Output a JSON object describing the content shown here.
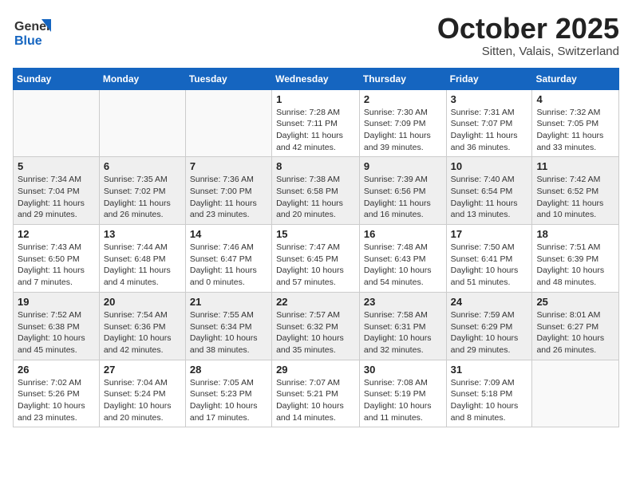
{
  "header": {
    "logo_general": "General",
    "logo_blue": "Blue",
    "month": "October 2025",
    "location": "Sitten, Valais, Switzerland"
  },
  "weekdays": [
    "Sunday",
    "Monday",
    "Tuesday",
    "Wednesday",
    "Thursday",
    "Friday",
    "Saturday"
  ],
  "weeks": [
    [
      {
        "day": "",
        "info": ""
      },
      {
        "day": "",
        "info": ""
      },
      {
        "day": "",
        "info": ""
      },
      {
        "day": "1",
        "info": "Sunrise: 7:28 AM\nSunset: 7:11 PM\nDaylight: 11 hours and 42 minutes."
      },
      {
        "day": "2",
        "info": "Sunrise: 7:30 AM\nSunset: 7:09 PM\nDaylight: 11 hours and 39 minutes."
      },
      {
        "day": "3",
        "info": "Sunrise: 7:31 AM\nSunset: 7:07 PM\nDaylight: 11 hours and 36 minutes."
      },
      {
        "day": "4",
        "info": "Sunrise: 7:32 AM\nSunset: 7:05 PM\nDaylight: 11 hours and 33 minutes."
      }
    ],
    [
      {
        "day": "5",
        "info": "Sunrise: 7:34 AM\nSunset: 7:04 PM\nDaylight: 11 hours and 29 minutes."
      },
      {
        "day": "6",
        "info": "Sunrise: 7:35 AM\nSunset: 7:02 PM\nDaylight: 11 hours and 26 minutes."
      },
      {
        "day": "7",
        "info": "Sunrise: 7:36 AM\nSunset: 7:00 PM\nDaylight: 11 hours and 23 minutes."
      },
      {
        "day": "8",
        "info": "Sunrise: 7:38 AM\nSunset: 6:58 PM\nDaylight: 11 hours and 20 minutes."
      },
      {
        "day": "9",
        "info": "Sunrise: 7:39 AM\nSunset: 6:56 PM\nDaylight: 11 hours and 16 minutes."
      },
      {
        "day": "10",
        "info": "Sunrise: 7:40 AM\nSunset: 6:54 PM\nDaylight: 11 hours and 13 minutes."
      },
      {
        "day": "11",
        "info": "Sunrise: 7:42 AM\nSunset: 6:52 PM\nDaylight: 11 hours and 10 minutes."
      }
    ],
    [
      {
        "day": "12",
        "info": "Sunrise: 7:43 AM\nSunset: 6:50 PM\nDaylight: 11 hours and 7 minutes."
      },
      {
        "day": "13",
        "info": "Sunrise: 7:44 AM\nSunset: 6:48 PM\nDaylight: 11 hours and 4 minutes."
      },
      {
        "day": "14",
        "info": "Sunrise: 7:46 AM\nSunset: 6:47 PM\nDaylight: 11 hours and 0 minutes."
      },
      {
        "day": "15",
        "info": "Sunrise: 7:47 AM\nSunset: 6:45 PM\nDaylight: 10 hours and 57 minutes."
      },
      {
        "day": "16",
        "info": "Sunrise: 7:48 AM\nSunset: 6:43 PM\nDaylight: 10 hours and 54 minutes."
      },
      {
        "day": "17",
        "info": "Sunrise: 7:50 AM\nSunset: 6:41 PM\nDaylight: 10 hours and 51 minutes."
      },
      {
        "day": "18",
        "info": "Sunrise: 7:51 AM\nSunset: 6:39 PM\nDaylight: 10 hours and 48 minutes."
      }
    ],
    [
      {
        "day": "19",
        "info": "Sunrise: 7:52 AM\nSunset: 6:38 PM\nDaylight: 10 hours and 45 minutes."
      },
      {
        "day": "20",
        "info": "Sunrise: 7:54 AM\nSunset: 6:36 PM\nDaylight: 10 hours and 42 minutes."
      },
      {
        "day": "21",
        "info": "Sunrise: 7:55 AM\nSunset: 6:34 PM\nDaylight: 10 hours and 38 minutes."
      },
      {
        "day": "22",
        "info": "Sunrise: 7:57 AM\nSunset: 6:32 PM\nDaylight: 10 hours and 35 minutes."
      },
      {
        "day": "23",
        "info": "Sunrise: 7:58 AM\nSunset: 6:31 PM\nDaylight: 10 hours and 32 minutes."
      },
      {
        "day": "24",
        "info": "Sunrise: 7:59 AM\nSunset: 6:29 PM\nDaylight: 10 hours and 29 minutes."
      },
      {
        "day": "25",
        "info": "Sunrise: 8:01 AM\nSunset: 6:27 PM\nDaylight: 10 hours and 26 minutes."
      }
    ],
    [
      {
        "day": "26",
        "info": "Sunrise: 7:02 AM\nSunset: 5:26 PM\nDaylight: 10 hours and 23 minutes."
      },
      {
        "day": "27",
        "info": "Sunrise: 7:04 AM\nSunset: 5:24 PM\nDaylight: 10 hours and 20 minutes."
      },
      {
        "day": "28",
        "info": "Sunrise: 7:05 AM\nSunset: 5:23 PM\nDaylight: 10 hours and 17 minutes."
      },
      {
        "day": "29",
        "info": "Sunrise: 7:07 AM\nSunset: 5:21 PM\nDaylight: 10 hours and 14 minutes."
      },
      {
        "day": "30",
        "info": "Sunrise: 7:08 AM\nSunset: 5:19 PM\nDaylight: 10 hours and 11 minutes."
      },
      {
        "day": "31",
        "info": "Sunrise: 7:09 AM\nSunset: 5:18 PM\nDaylight: 10 hours and 8 minutes."
      },
      {
        "day": "",
        "info": ""
      }
    ]
  ]
}
